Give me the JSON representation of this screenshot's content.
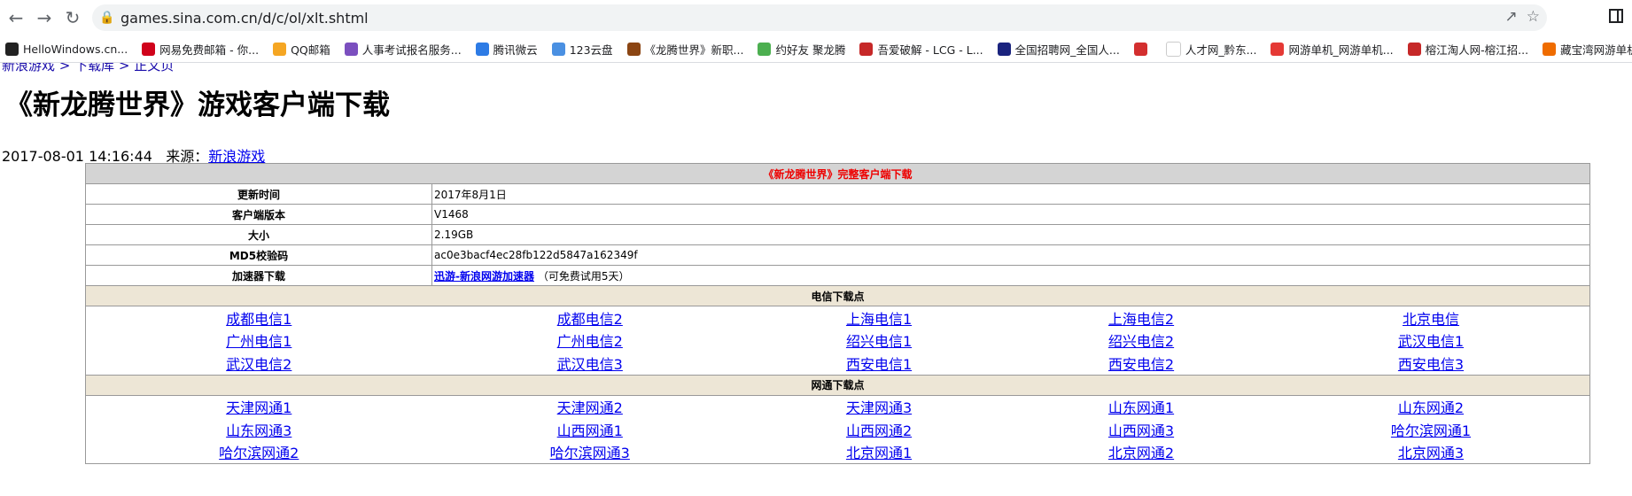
{
  "browser": {
    "url": "games.sina.com.cn/d/c/ol/xlt.shtml",
    "bookmarks": [
      {
        "label": "HelloWindows.cn...",
        "color": "#222"
      },
      {
        "label": "网易免费邮箱 - 你...",
        "color": "#d0021b"
      },
      {
        "label": "QQ邮箱",
        "color": "#f5a623"
      },
      {
        "label": "人事考试报名服务...",
        "color": "#7b4fbf"
      },
      {
        "label": "腾讯微云",
        "color": "#2d7be5"
      },
      {
        "label": "123云盘",
        "color": "#4a90e2"
      },
      {
        "label": "《龙腾世界》新职...",
        "color": "#8b4513"
      },
      {
        "label": "约好友 聚龙腾",
        "color": "#4caf50"
      },
      {
        "label": "吾爱破解 - LCG - L...",
        "color": "#c62828"
      },
      {
        "label": "全国招聘网_全国人...",
        "color": "#1a237e"
      },
      {
        "label": "",
        "color": "#d32f2f"
      },
      {
        "label": "人才网_黔东...",
        "color": "#ffffff"
      },
      {
        "label": "网游单机_网游单机...",
        "color": "#e53935"
      },
      {
        "label": "榕江淘人网-榕江招...",
        "color": "#c62828"
      },
      {
        "label": "藏宝湾网游单机游",
        "color": "#ef6c00"
      }
    ]
  },
  "page": {
    "breadcrumb": "新浪游戏 > 下载库 > 正文页",
    "title": "《新龙腾世界》游戏客户端下载",
    "date": "2017-08-01 14:16:44",
    "source_label": "来源：",
    "source_link": "新浪游戏"
  },
  "table": {
    "header": "《新龙腾世界》完整客户端下载",
    "rows": [
      {
        "label": "更新时间",
        "value": "2017年8月1日"
      },
      {
        "label": "客户端版本",
        "value": "V1468"
      },
      {
        "label": "大小",
        "value": "2.19GB"
      },
      {
        "label": "MD5校验码",
        "value": "ac0e3bacf4ec28fb122d5847a162349f"
      }
    ],
    "accelerator": {
      "label": "加速器下载",
      "link": "迅游-新浪网游加速器",
      "note": "（可免费试用5天）"
    },
    "telecom_title": "电信下载点",
    "telecom": [
      [
        "成都电信1",
        "成都电信2",
        "上海电信1",
        "上海电信2",
        "北京电信"
      ],
      [
        "广州电信1",
        "广州电信2",
        "绍兴电信1",
        "绍兴电信2",
        "武汉电信1"
      ],
      [
        "武汉电信2",
        "武汉电信3",
        "西安电信1",
        "西安电信2",
        "西安电信3"
      ]
    ],
    "netcom_title": "网通下载点",
    "netcom": [
      [
        "天津网通1",
        "天津网通2",
        "天津网通3",
        "山东网通1",
        "山东网通2"
      ],
      [
        "山东网通3",
        "山西网通1",
        "山西网通2",
        "山西网通3",
        "哈尔滨网通1"
      ],
      [
        "哈尔滨网通2",
        "哈尔滨网通3",
        "北京网通1",
        "北京网通2",
        "北京网通3"
      ]
    ]
  }
}
